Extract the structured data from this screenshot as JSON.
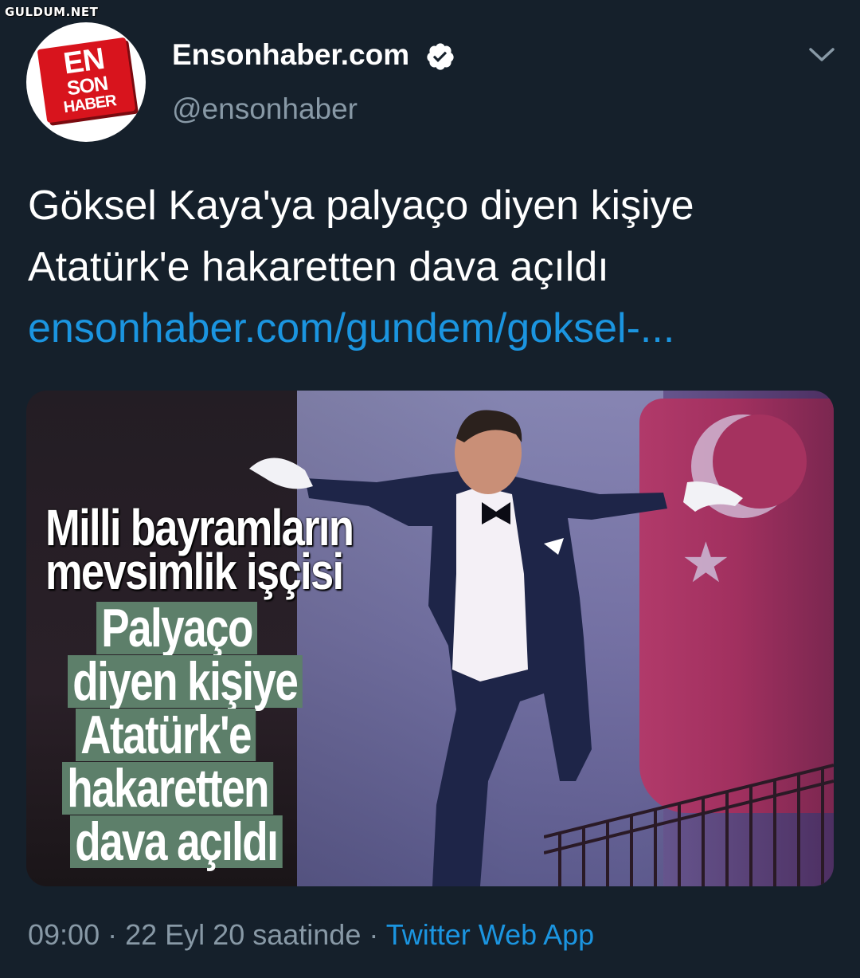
{
  "watermark": "GULDUM.NET",
  "account": {
    "display_name": "Ensonhaber.com",
    "handle": "@ensonhaber",
    "logo_lines": [
      "EN",
      "SON",
      "HABER"
    ],
    "verified_icon": "verified-badge-icon"
  },
  "menu_icon": "chevron-down-icon",
  "tweet": {
    "line1": "Göksel Kaya'ya palyaço diyen kişiye",
    "line2": "Atatürk'e hakaretten dava açıldı",
    "link": "ensonhaber.com/gundem/goksel-..."
  },
  "media": {
    "headline_lines": [
      "Milli bayramların",
      "mevsimlik işçisi"
    ],
    "subhead_lines": [
      "Palyaço",
      "diyen kişiye",
      "Atatürk'e",
      "hakaretten",
      "dava açıldı"
    ]
  },
  "meta": {
    "time": "09:00",
    "date": "22 Eyl 20 saatinde",
    "separator": "·",
    "app": "Twitter Web App"
  },
  "colors": {
    "background": "#15202b",
    "link": "#1b95e0",
    "secondary_text": "#8899a6",
    "logo_red": "#d8141d",
    "caption_box": "#5d7f6a"
  }
}
